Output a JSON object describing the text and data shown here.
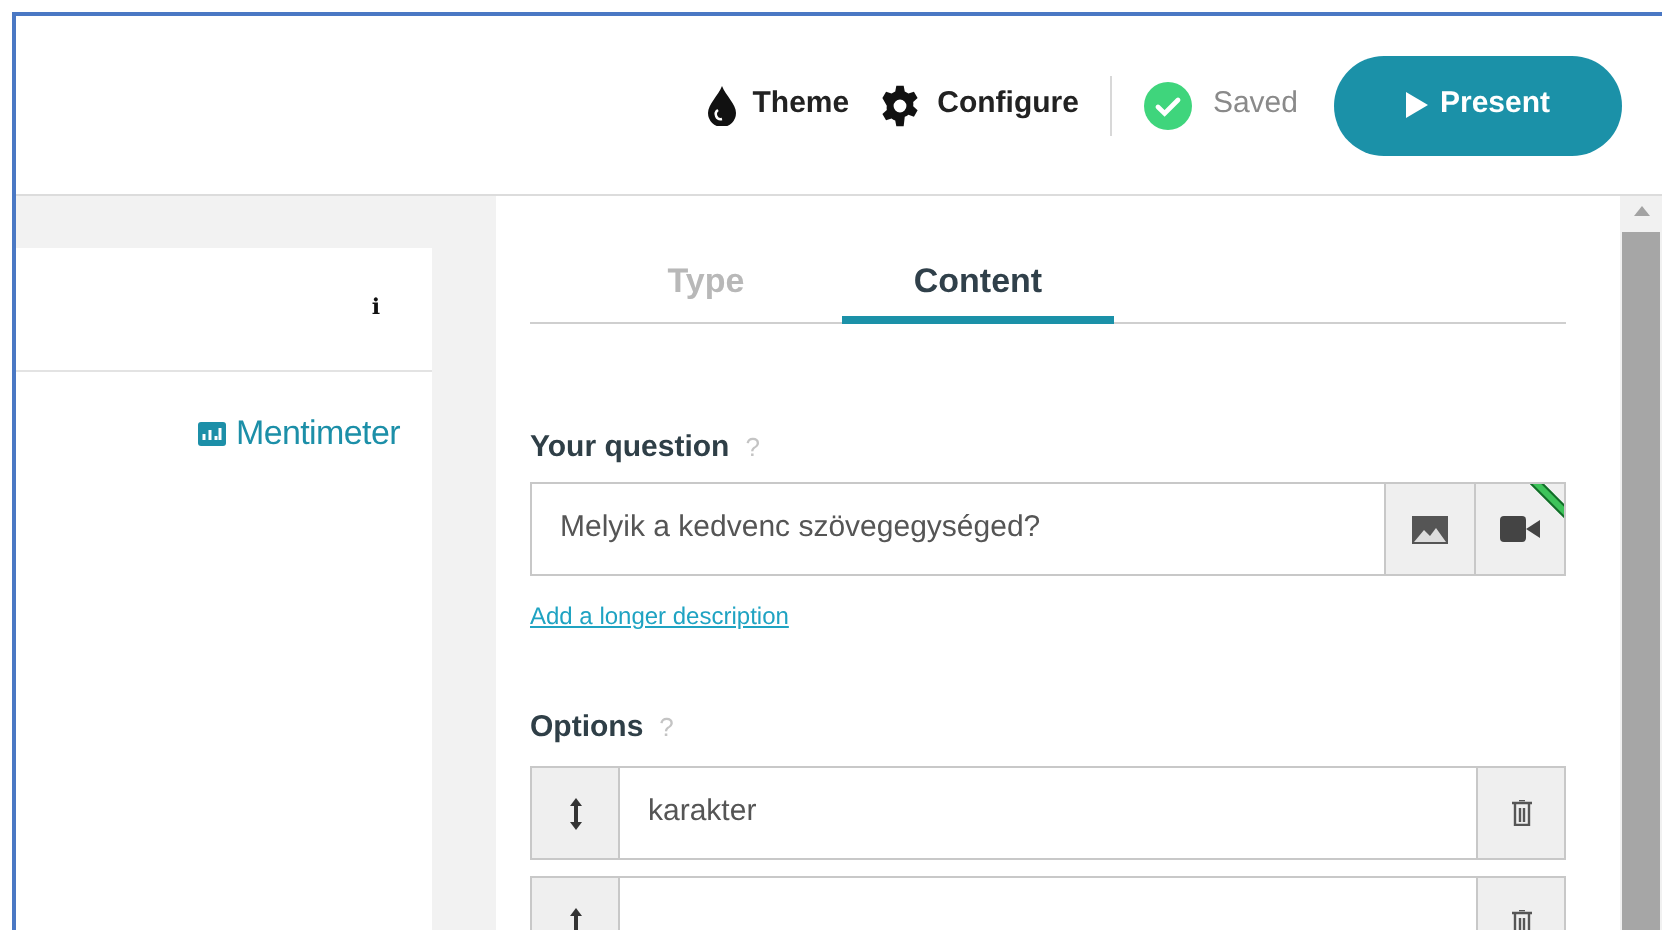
{
  "toolbar": {
    "theme": "Theme",
    "configure": "Configure",
    "status": "Saved",
    "present": "Present"
  },
  "preview": {
    "info": "i",
    "brand": "Mentimeter"
  },
  "tabs": [
    {
      "label": "Type",
      "selected": false
    },
    {
      "label": "Content",
      "selected": true
    }
  ],
  "question": {
    "label": "Your question",
    "help": "?",
    "value": "Melyik a kedvenc szövegegységed?",
    "link": "Add a longer description"
  },
  "options": {
    "label": "Options",
    "help": "?",
    "items": [
      {
        "value": "karakter"
      }
    ]
  }
}
